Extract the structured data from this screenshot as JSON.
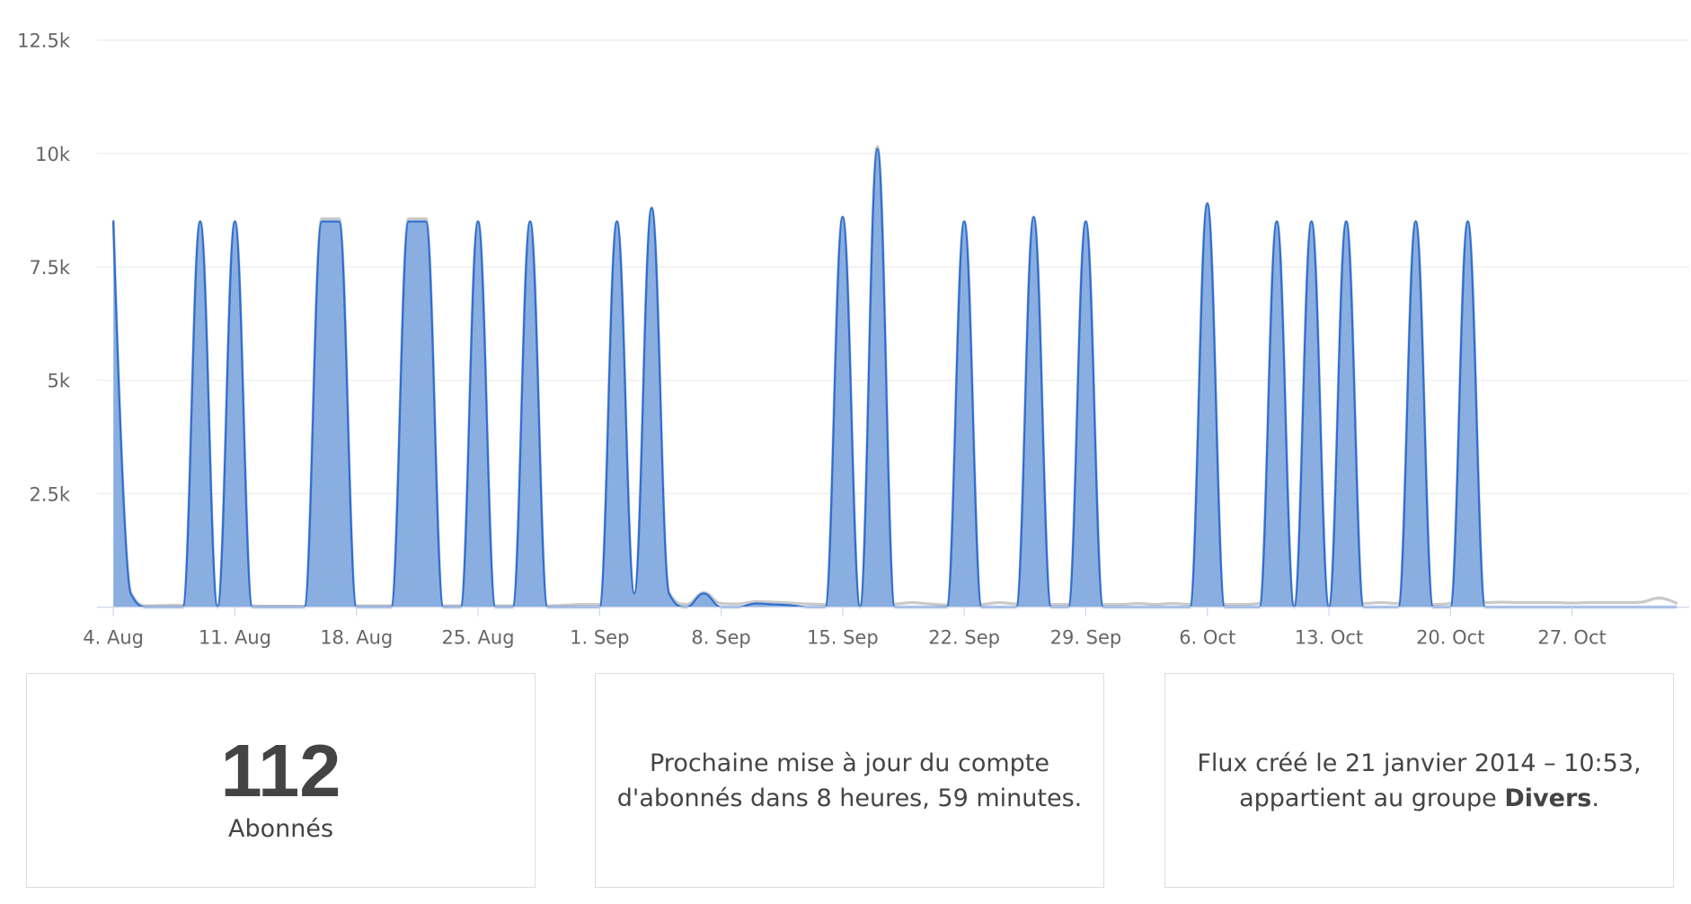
{
  "chart_data": {
    "type": "area",
    "smooth": true,
    "title": "",
    "xlabel": "",
    "ylabel": "",
    "x": [
      "4. Aug",
      "5. Aug",
      "6. Aug",
      "7. Aug",
      "8. Aug",
      "9. Aug",
      "10. Aug",
      "11. Aug",
      "12. Aug",
      "13. Aug",
      "14. Aug",
      "15. Aug",
      "16. Aug",
      "17. Aug",
      "18. Aug",
      "19. Aug",
      "20. Aug",
      "21. Aug",
      "22. Aug",
      "23. Aug",
      "24. Aug",
      "25. Aug",
      "26. Aug",
      "27. Aug",
      "28. Aug",
      "29. Aug",
      "30. Aug",
      "31. Aug",
      "1. Sep",
      "2. Sep",
      "3. Sep",
      "4. Sep",
      "5. Sep",
      "6. Sep",
      "7. Sep",
      "8. Sep",
      "9. Sep",
      "10. Sep",
      "11. Sep",
      "12. Sep",
      "13. Sep",
      "14. Sep",
      "15. Sep",
      "16. Sep",
      "17. Sep",
      "18. Sep",
      "19. Sep",
      "20. Sep",
      "21. Sep",
      "22. Sep",
      "23. Sep",
      "24. Sep",
      "25. Sep",
      "26. Sep",
      "27. Sep",
      "28. Sep",
      "29. Sep",
      "30. Sep",
      "1. Oct",
      "2. Oct",
      "3. Oct",
      "4. Oct",
      "5. Oct",
      "6. Oct",
      "7. Oct",
      "8. Oct",
      "9. Oct",
      "10. Oct",
      "11. Oct",
      "12. Oct",
      "13. Oct",
      "14. Oct",
      "15. Oct",
      "16. Oct",
      "17. Oct",
      "18. Oct",
      "19. Oct",
      "20. Oct",
      "21. Oct",
      "22. Oct",
      "23. Oct",
      "24. Oct",
      "25. Oct",
      "26. Oct",
      "27. Oct",
      "28. Oct",
      "29. Oct",
      "30. Oct",
      "31. Oct",
      "1. Nov",
      "2. Nov"
    ],
    "series": [
      {
        "color": "#2e6fd0",
        "fill": "#8aaee0",
        "values": [
          8500,
          300,
          0,
          0,
          0,
          8500,
          0,
          8500,
          0,
          0,
          0,
          0,
          8500,
          8500,
          0,
          0,
          0,
          8500,
          8500,
          0,
          0,
          8500,
          0,
          0,
          8500,
          0,
          0,
          0,
          0,
          8500,
          300,
          8800,
          300,
          0,
          300,
          0,
          0,
          80,
          60,
          40,
          0,
          0,
          8600,
          0,
          10100,
          0,
          0,
          0,
          0,
          8500,
          0,
          0,
          0,
          8600,
          0,
          0,
          8500,
          0,
          0,
          0,
          0,
          0,
          0,
          8900,
          0,
          0,
          0,
          8500,
          0,
          8500,
          0,
          8500,
          0,
          0,
          0,
          8500,
          0,
          0,
          8500,
          0,
          0,
          0,
          0,
          0,
          0,
          0,
          0,
          0,
          0,
          0,
          0
        ]
      },
      {
        "color": "#c9c9c9",
        "values": [
          8500,
          320,
          30,
          40,
          40,
          8500,
          30,
          8500,
          30,
          20,
          20,
          20,
          8560,
          8560,
          30,
          30,
          30,
          8560,
          8560,
          30,
          30,
          8500,
          30,
          30,
          8500,
          30,
          40,
          60,
          60,
          8500,
          300,
          8800,
          320,
          60,
          320,
          80,
          70,
          120,
          110,
          90,
          70,
          60,
          8600,
          60,
          10150,
          70,
          100,
          70,
          50,
          8500,
          60,
          100,
          70,
          8600,
          60,
          60,
          8500,
          60,
          60,
          80,
          60,
          80,
          60,
          8900,
          60,
          60,
          80,
          8500,
          60,
          8500,
          60,
          8500,
          80,
          100,
          80,
          8500,
          60,
          80,
          8500,
          100,
          110,
          100,
          100,
          100,
          90,
          100,
          100,
          100,
          110,
          200,
          90
        ]
      }
    ],
    "ylim": [
      0,
      12500
    ],
    "y_ticks": [
      2500,
      5000,
      7500,
      10000,
      12500
    ],
    "y_tick_labels": [
      "2.5k",
      "5k",
      "7.5k",
      "10k",
      "12.5k"
    ],
    "x_tick_labels": [
      "4. Aug",
      "11. Aug",
      "18. Aug",
      "25. Aug",
      "1. Sep",
      "8. Sep",
      "15. Sep",
      "22. Sep",
      "29. Sep",
      "6. Oct",
      "13. Oct",
      "20. Oct",
      "27. Oct"
    ],
    "grid": true,
    "legend": "none"
  },
  "stats": {
    "subscribers": {
      "value": "112",
      "label": "Abonnés"
    },
    "next_update": {
      "line1": "Prochaine mise à jour du compte",
      "line2": "d'abonnés dans 8 heures, 59 minutes."
    },
    "created": {
      "line1": "Flux créé le 21 janvier 2014 – 10:53,",
      "line2_prefix": "appartient au groupe ",
      "group": "Divers",
      "line2_suffix": "."
    }
  }
}
